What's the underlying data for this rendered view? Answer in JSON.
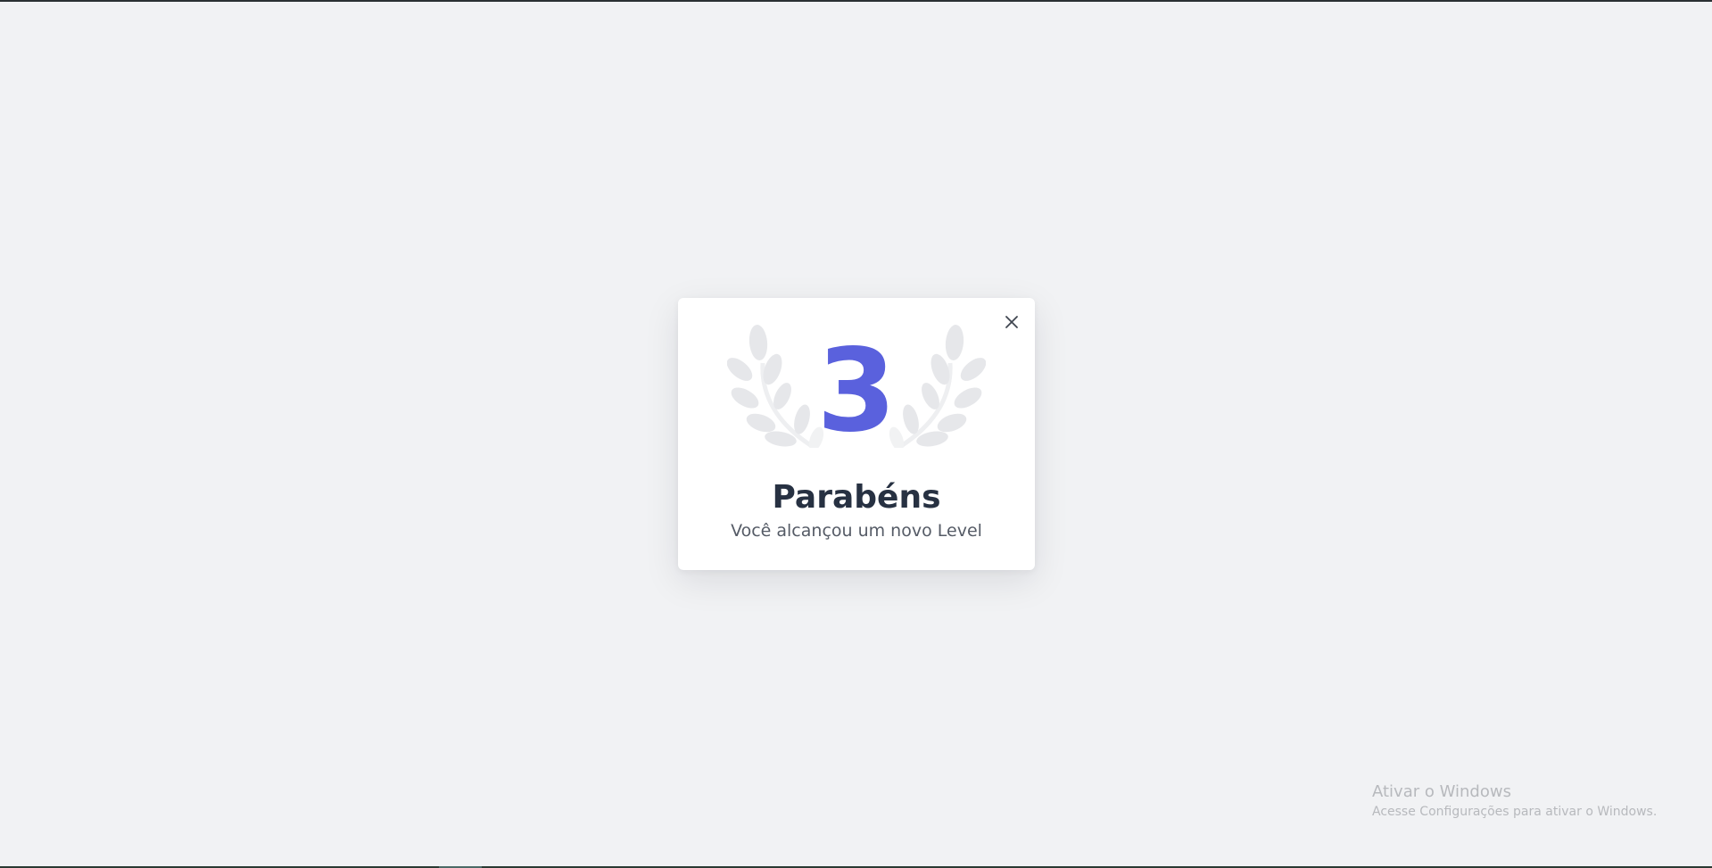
{
  "modal": {
    "level": "3",
    "title": "Parabéns",
    "subtitle": "Você alcançou um novo Level",
    "close_icon": "close-icon",
    "decoration_icon": "laurel-wreath-icon"
  },
  "watermark": {
    "title": "Ativar o Windows",
    "subtitle": "Acesse Configurações para ativar o Windows."
  },
  "colors": {
    "accent": "#5a61dd",
    "title": "#273142",
    "subtitle": "#555b66",
    "background": "#f1f2f4",
    "laurel": "#e6e7ea"
  }
}
